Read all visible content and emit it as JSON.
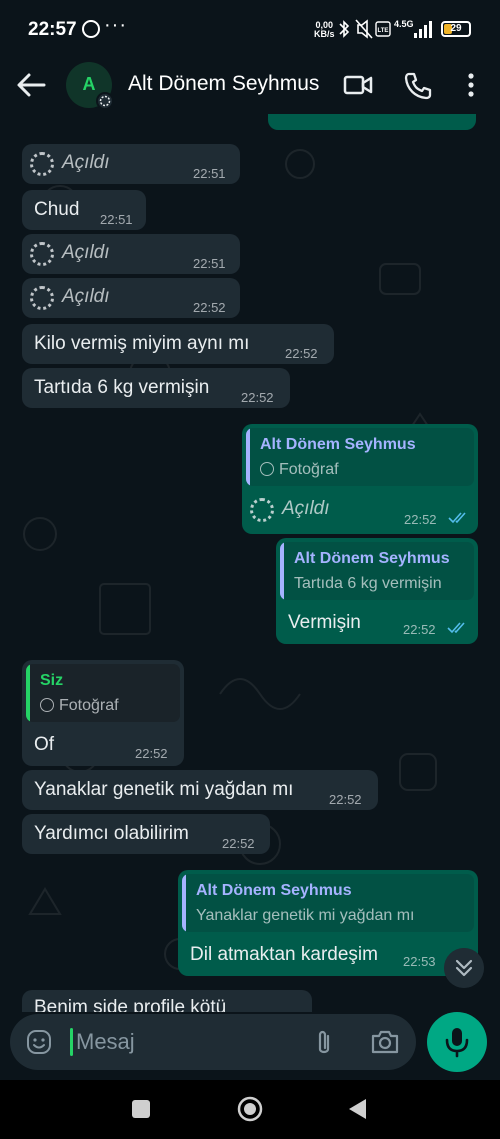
{
  "status_bar": {
    "time": "22:57",
    "net_speed_value": "0,00",
    "net_speed_unit": "KB/s",
    "network": "4.5G",
    "battery": "29"
  },
  "header": {
    "avatar_letter": "A",
    "contact_name": "Alt Dönem Seyhmus"
  },
  "messages": {
    "m1": {
      "text": "Açıldı",
      "time": "22:51"
    },
    "m2": {
      "text": "Chud",
      "time": "22:51"
    },
    "m3": {
      "text": "Açıldı",
      "time": "22:51"
    },
    "m4": {
      "text": "Açıldı",
      "time": "22:52"
    },
    "m5": {
      "text": "Kilo vermiş miyim aynı mı",
      "time": "22:52"
    },
    "m6": {
      "text": "Tartıda 6 kg vermişin",
      "time": "22:52"
    },
    "m7": {
      "quote_name": "Alt Dönem Seyhmus",
      "quote_text": "Fotoğraf",
      "text": "Açıldı",
      "time": "22:52"
    },
    "m8": {
      "quote_name": "Alt Dönem Seyhmus",
      "quote_text": "Tartıda 6 kg vermişin",
      "text": "Vermişin",
      "time": "22:52"
    },
    "m9": {
      "quote_name": "Siz",
      "quote_text": "Fotoğraf",
      "text": "Of",
      "time": "22:52"
    },
    "m10": {
      "text": "Yanaklar genetik mi yağdan mı",
      "time": "22:52"
    },
    "m11": {
      "text": "Yardımcı olabilirim",
      "time": "22:52"
    },
    "m12": {
      "quote_name": "Alt Dönem Seyhmus",
      "quote_text": "Yanaklar genetik mi yağdan mı",
      "text": "Dil atmaktan kardeşim",
      "time": "22:53"
    },
    "m13": {
      "text": "Benim side profile kötü"
    }
  },
  "input": {
    "placeholder": "Mesaj"
  },
  "colors": {
    "background": "#0b141a",
    "incoming_bubble": "#1f2c34",
    "outgoing_bubble": "#005c4b",
    "accent": "#00a884",
    "read_ticks": "#53bdeb",
    "quote_contact": "#a5b3ff",
    "quote_self": "#25d366"
  },
  "icons": {
    "back": "arrow-left-icon",
    "video": "video-camera-icon",
    "call": "phone-icon",
    "menu": "more-vertical-icon",
    "emoji": "emoji-icon",
    "attach": "paperclip-icon",
    "camera": "camera-icon",
    "mic": "microphone-icon",
    "scroll": "double-chevron-down-icon",
    "view_once": "view-once-icon"
  }
}
